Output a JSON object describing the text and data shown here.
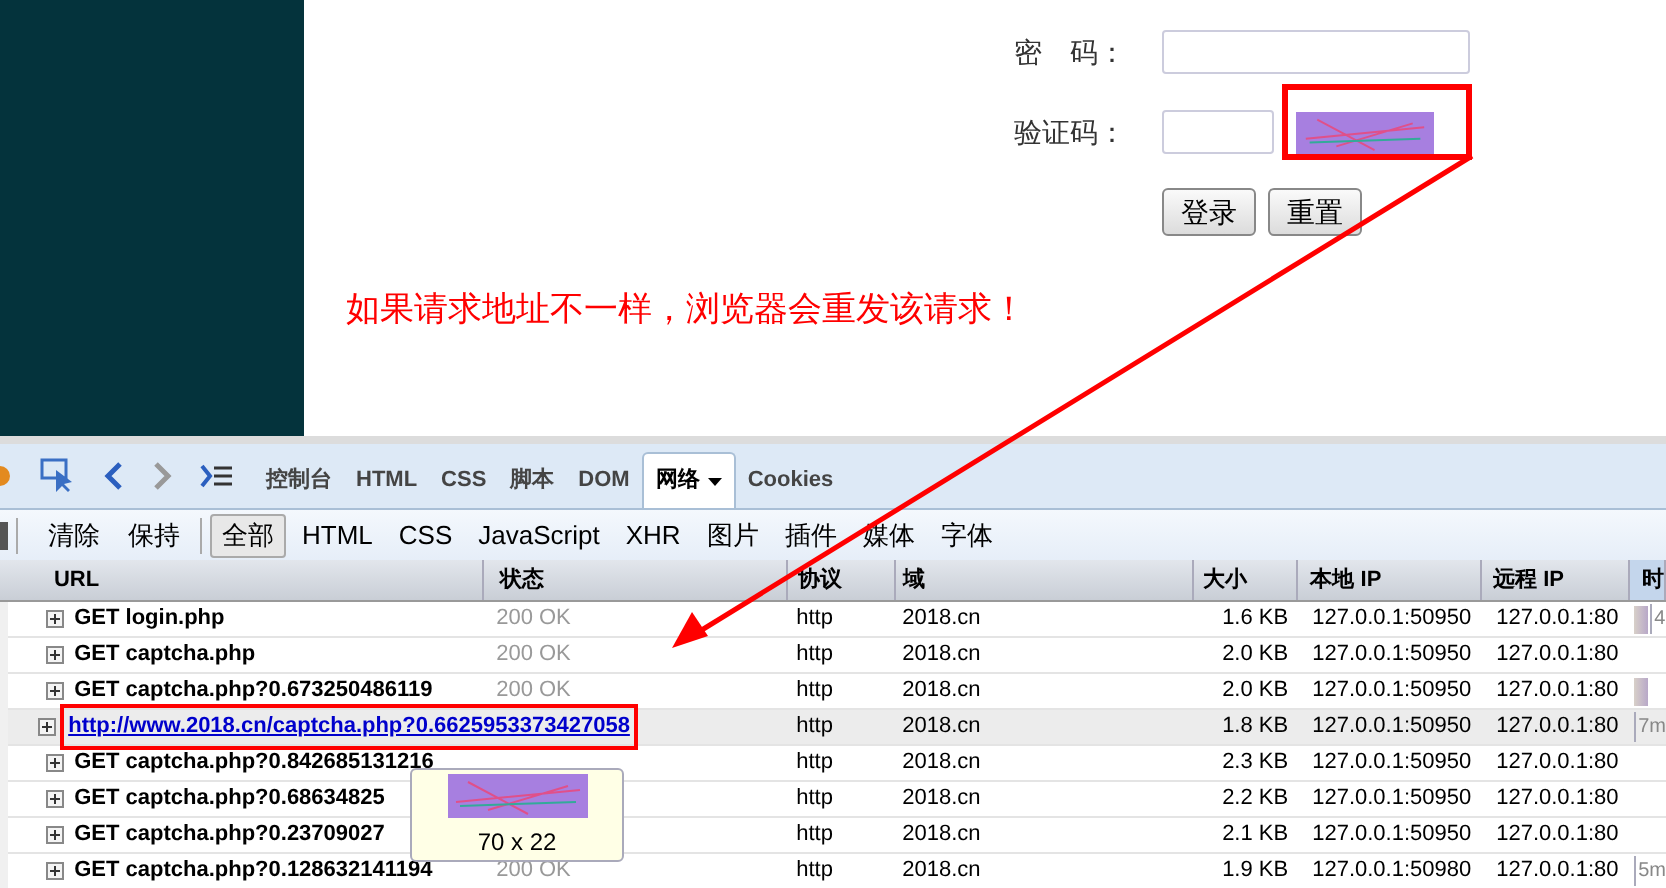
{
  "login_form": {
    "fields": [
      {
        "label": "密　码：",
        "kind": "text"
      },
      {
        "label": "验证码：",
        "kind": "captcha"
      }
    ],
    "buttons": [
      "登录",
      "重置"
    ]
  },
  "annotation": {
    "message": "如果请求地址不一样，浏览器会重发该请求！"
  },
  "devtools": {
    "tabs": [
      {
        "label": "控制台",
        "selected": false
      },
      {
        "label": "HTML",
        "selected": false
      },
      {
        "label": "CSS",
        "selected": false
      },
      {
        "label": "脚本",
        "selected": false
      },
      {
        "label": "DOM",
        "selected": false
      },
      {
        "label": "网络",
        "selected": true,
        "dropdown": true
      },
      {
        "label": "Cookies",
        "selected": false
      }
    ],
    "actions": [
      "清除",
      "保持"
    ],
    "filters": [
      {
        "label": "全部",
        "selected": true
      },
      {
        "label": "HTML",
        "selected": false
      },
      {
        "label": "CSS",
        "selected": false
      },
      {
        "label": "JavaScript",
        "selected": false
      },
      {
        "label": "XHR",
        "selected": false
      },
      {
        "label": "图片",
        "selected": false
      },
      {
        "label": "插件",
        "selected": false
      },
      {
        "label": "媒体",
        "selected": false
      },
      {
        "label": "字体",
        "selected": false
      }
    ],
    "table": {
      "columns": [
        "URL",
        "状态",
        "协议",
        "域",
        "大小",
        "本地 IP",
        "远程 IP",
        "时"
      ],
      "rows": [
        {
          "url": "GET login.php",
          "status": "200 OK",
          "protocol": "http",
          "domain": "2018.cn",
          "size": "1.6 KB",
          "local_ip": "127.0.0.1:50950",
          "remote_ip": "127.0.0.1:80",
          "timeline_bar": true,
          "timeline_text": "4",
          "selected": false,
          "link": false
        },
        {
          "url": "GET captcha.php",
          "status": "200 OK",
          "protocol": "http",
          "domain": "2018.cn",
          "size": "2.0 KB",
          "local_ip": "127.0.0.1:50950",
          "remote_ip": "127.0.0.1:80",
          "timeline_bar": false,
          "selected": false,
          "link": false
        },
        {
          "url": "GET captcha.php?0.673250486119",
          "status": "200 OK",
          "protocol": "http",
          "domain": "2018.cn",
          "size": "2.0 KB",
          "local_ip": "127.0.0.1:50950",
          "remote_ip": "127.0.0.1:80",
          "timeline_bar": true,
          "selected": false,
          "link": false
        },
        {
          "url": "http://www.2018.cn/captcha.php?0.6625953373427058",
          "protocol": "http",
          "domain": "2018.cn",
          "size": "1.8 KB",
          "local_ip": "127.0.0.1:50950",
          "remote_ip": "127.0.0.1:80",
          "timeline_bar": false,
          "timeline_text": "7m",
          "selected": true,
          "link": true
        },
        {
          "url": "GET captcha.php?0.842685131216",
          "protocol": "http",
          "domain": "2018.cn",
          "size": "2.3 KB",
          "local_ip": "127.0.0.1:50950",
          "remote_ip": "127.0.0.1:80",
          "timeline_bar": false,
          "selected": false,
          "link": false
        },
        {
          "url": "GET captcha.php?0.68634825",
          "protocol": "http",
          "domain": "2018.cn",
          "size": "2.2 KB",
          "local_ip": "127.0.0.1:50950",
          "remote_ip": "127.0.0.1:80",
          "timeline_bar": false,
          "selected": false,
          "link": false
        },
        {
          "url": "GET captcha.php?0.23709027",
          "protocol": "http",
          "domain": "2018.cn",
          "size": "2.1 KB",
          "local_ip": "127.0.0.1:50950",
          "remote_ip": "127.0.0.1:80",
          "timeline_bar": false,
          "selected": false,
          "link": false
        },
        {
          "url": "GET captcha.php?0.128632141194",
          "status": "200 OK",
          "protocol": "http",
          "domain": "2018.cn",
          "size": "1.9 KB",
          "local_ip": "127.0.0.1:50980",
          "remote_ip": "127.0.0.1:80",
          "timeline_bar": false,
          "timeline_text": "5m",
          "selected": false,
          "link": false
        }
      ]
    },
    "tooltip": {
      "dimensions": "70 x 22"
    }
  }
}
